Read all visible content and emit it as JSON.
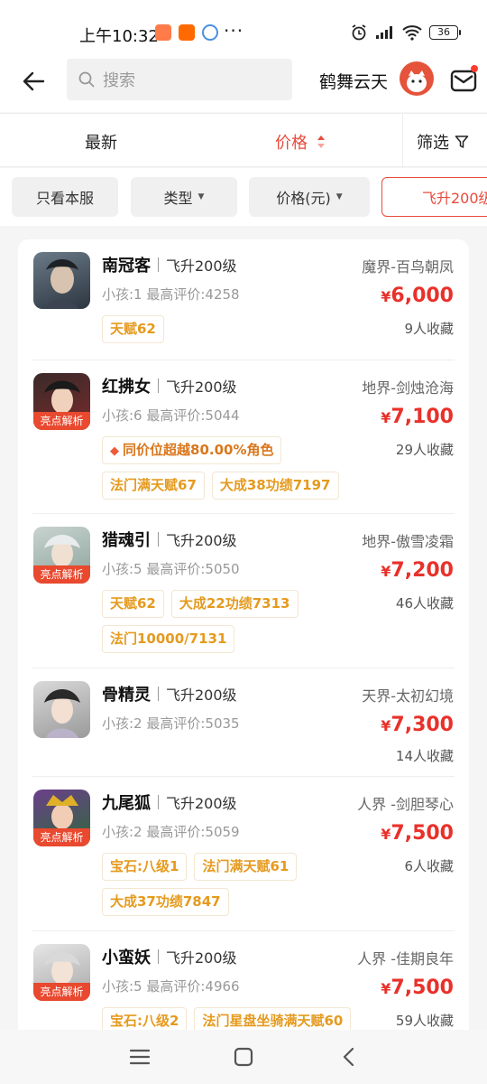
{
  "status": {
    "time": "上午10:32",
    "battery": "36"
  },
  "search": {
    "placeholder": "搜索"
  },
  "header": {
    "server_name": "鹤舞云天"
  },
  "sort": {
    "latest": "最新",
    "price": "价格",
    "filter": "筛选"
  },
  "chips": [
    {
      "label": "只看本服"
    },
    {
      "label": "类型"
    },
    {
      "label": "价格(元)"
    },
    {
      "label": "飞升200级"
    }
  ],
  "items": [
    {
      "name": "南冠客",
      "level": "飞升200级",
      "server": "魔界-百鸟朝凤",
      "sub": "小孩:1 最高评价:4258",
      "yen": "¥",
      "price": "6,000",
      "favs": "9人收藏",
      "badge": "",
      "special": "",
      "tags": [
        [
          "天赋62"
        ]
      ]
    },
    {
      "name": "红拂女",
      "level": "飞升200级",
      "server": "地界-剑烛沧海",
      "sub": "小孩:6 最高评价:5044",
      "yen": "¥",
      "price": "7,100",
      "favs": "29人收藏",
      "badge": "亮点解析",
      "special": "同价位超越80.00%角色",
      "tags": [
        [
          "法门满天赋67",
          "大成38功绩7197"
        ]
      ]
    },
    {
      "name": "猎魂引",
      "level": "飞升200级",
      "server": "地界-傲雪凌霜",
      "sub": "小孩:5 最高评价:5050",
      "yen": "¥",
      "price": "7,200",
      "favs": "46人收藏",
      "badge": "亮点解析",
      "special": "",
      "tags": [
        [
          "天赋62",
          "大成22功绩7313"
        ],
        [
          "法门10000/7131"
        ]
      ]
    },
    {
      "name": "骨精灵",
      "level": "飞升200级",
      "server": "天界-太初幻境",
      "sub": "小孩:2 最高评价:5035",
      "yen": "¥",
      "price": "7,300",
      "favs": "14人收藏",
      "badge": "",
      "special": "",
      "tags": []
    },
    {
      "name": "九尾狐",
      "level": "飞升200级",
      "server": "人界 -剑胆琴心",
      "sub": "小孩:2 最高评价:5059",
      "yen": "¥",
      "price": "7,500",
      "favs": "6人收藏",
      "badge": "亮点解析",
      "special": "",
      "tags": [
        [
          "宝石:八级1",
          "法门满天赋61"
        ],
        [
          "大成37功绩7847"
        ]
      ]
    },
    {
      "name": "小蛮妖",
      "level": "飞升200级",
      "server": "人界 -佳期良年",
      "sub": "小孩:5 最高评价:4966",
      "yen": "¥",
      "price": "7,500",
      "favs": "59人收藏",
      "badge": "亮点解析",
      "special": "",
      "tags": [
        [
          "宝石:八级2",
          "法门星盘坐骑满天赋60"
        ]
      ]
    }
  ],
  "colors": {
    "accent": "#e94b3c",
    "price": "#e8312a",
    "tag": "#e59a1e"
  },
  "icons": [
    "back-arrow-icon",
    "search-icon",
    "mail-icon",
    "sort-arrows-icon",
    "filter-icon",
    "dropdown-triangle-icon",
    "menu-icon",
    "home-square-icon",
    "back-chevron-icon"
  ]
}
